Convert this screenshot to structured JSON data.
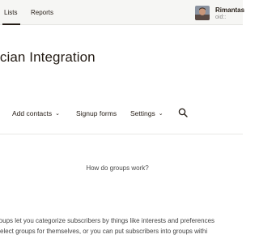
{
  "topbar": {
    "nav": [
      {
        "label": "Lists"
      },
      {
        "label": "Reports"
      }
    ],
    "account": {
      "name": "Rimantas",
      "sub": "oid::"
    }
  },
  "page": {
    "title": "ician Integration"
  },
  "subnav": {
    "items": [
      {
        "label": "Add contacts",
        "icon": "chevron-down-icon"
      },
      {
        "label": "Signup forms"
      },
      {
        "label": "Settings",
        "icon": "chevron-down-icon"
      }
    ],
    "search_icon": "search-icon"
  },
  "groups": {
    "help_link": "How do groups work?",
    "line1": "roups let you categorize subscribers by things like interests and preferences",
    "line2": "select groups for themselves, or you can put subscribers into groups withi"
  },
  "colors": {
    "topbar_bg": "#f6f6f4",
    "text": "#241c15"
  }
}
